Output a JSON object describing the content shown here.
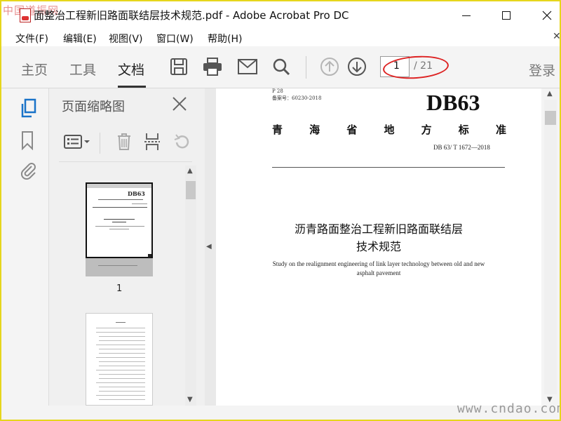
{
  "window": {
    "title": "面整治工程新旧路面联结层技术规范.pdf - Adobe Acrobat Pro DC",
    "watermark_top_left": "中国道振网",
    "watermark_bottom_right": "www.cndao.com"
  },
  "menu": {
    "items": [
      "文件(F)",
      "编辑(E)",
      "视图(V)",
      "窗口(W)",
      "帮助(H)"
    ]
  },
  "toolbar": {
    "tabs": [
      "主页",
      "工具",
      "文档"
    ],
    "active_tab": "文档",
    "current_page": "1",
    "total_pages": "/ 21",
    "login": "登录"
  },
  "panel": {
    "title": "页面缩略图",
    "thumb1_number": "1",
    "thumb1_db": "DB63"
  },
  "document": {
    "class_code": "P 28",
    "record_no": "备案号：60230-2018",
    "db_code": "DB63",
    "province_chars": [
      "青",
      "海",
      "省",
      "地",
      "方",
      "标",
      "准"
    ],
    "std_no": "DB 63/ T 1672—2018",
    "title_line1": "沥青路面整治工程新旧路面联结层",
    "title_line2": "技术规范",
    "en_line1": "Study on the realignment engineering of link layer technology between old and new",
    "en_line2": "asphalt pavement"
  },
  "colors": {
    "accent_red": "#d22222",
    "frame_yellow": "#e6d61c"
  }
}
